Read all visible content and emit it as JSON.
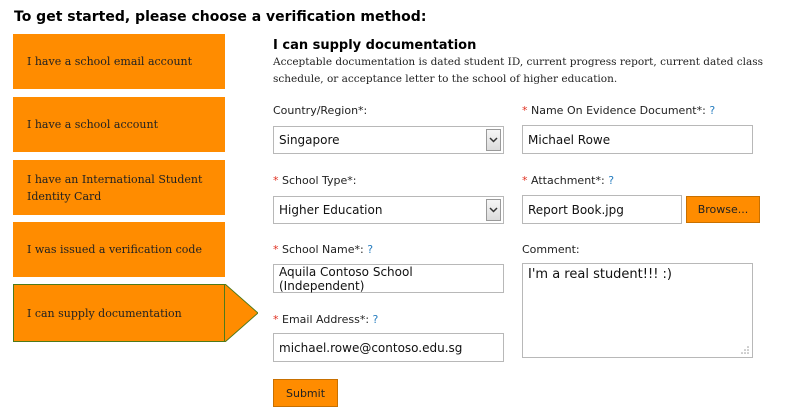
{
  "page": {
    "heading": "To get started, please choose a verification method:"
  },
  "methods": [
    {
      "label": "I have a school email account"
    },
    {
      "label": "I have a school account"
    },
    {
      "label": "I have an International Student Identity Card"
    },
    {
      "label": "I was issued a verification code"
    },
    {
      "label": "I can supply documentation",
      "selected": true
    }
  ],
  "section": {
    "title": "I can supply documentation",
    "description": "Acceptable documentation is dated student ID, current progress report, current dated class schedule, or acceptance letter to the school of higher education."
  },
  "form": {
    "required_mark": "*",
    "help_mark": "?",
    "country": {
      "label": "Country/Region*:",
      "value": "Singapore"
    },
    "school_type": {
      "label": "School Type*:",
      "value": "Higher Education"
    },
    "school_name": {
      "label": "School Name*:",
      "value": "Aquila Contoso School (Independent)"
    },
    "email": {
      "label": "Email Address*:",
      "value": "michael.rowe@contoso.edu.sg"
    },
    "evidence_name": {
      "label": "Name On Evidence Document*:",
      "value": "Michael Rowe"
    },
    "attachment": {
      "label": "Attachment*:",
      "value": "Report Book.jpg",
      "browse_label": "Browse..."
    },
    "comment": {
      "label": "Comment:",
      "value": "I'm a real student!!! :)"
    },
    "submit_label": "Submit"
  },
  "colors": {
    "accent": "#ff8c00",
    "active_border": "#4e7a1a",
    "required": "#e03020",
    "help": "#2a7fc0"
  },
  "icons": {
    "dropdown": "chevron-down-icon",
    "resize": "resize-grip-icon",
    "pointer": "selection-arrow-icon"
  }
}
